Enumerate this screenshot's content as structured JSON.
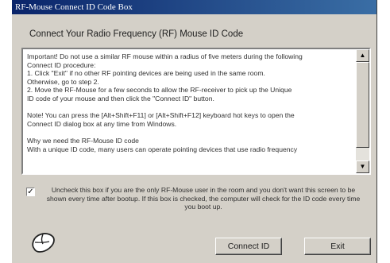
{
  "window": {
    "title": "RF-Mouse Connect ID Code Box",
    "header": "Connect Your Radio Frequency (RF) Mouse ID Code"
  },
  "info_box": {
    "lines": [
      "Important!  Do not use a similar RF mouse within a radius of five meters during the following",
      "Connect ID procedure:",
      "  1. Click \"Exit\" if no other RF pointing devices are being used in the same room.",
      "Otherwise, go to step 2.",
      "  2. Move the RF-Mouse for a few seconds to allow the RF-receiver to pick up the Unique",
      "ID code of your mouse and then click the \"Connect ID\" button.",
      "",
      "Note!  You can press the [Alt+Shift+F11] or [Alt+Shift+F12] keyboard hot keys to open the",
      "Connect ID dialog box at any time from Windows.",
      "",
      "Why we need the RF-Mouse ID code",
      "With a unique ID code, many users can operate pointing devices that use radio frequency"
    ]
  },
  "checkbox": {
    "checked": true,
    "mark": "✓",
    "label": "Uncheck this box if you are the only RF-Mouse user in the room and you don't want this screen to be shown every time after bootup. If this box is checked, the computer will check for the ID code every time you boot up."
  },
  "buttons": {
    "connect": "Connect ID",
    "exit": "Exit"
  },
  "icons": {
    "scroll_up": "▲",
    "scroll_down": "▼"
  }
}
